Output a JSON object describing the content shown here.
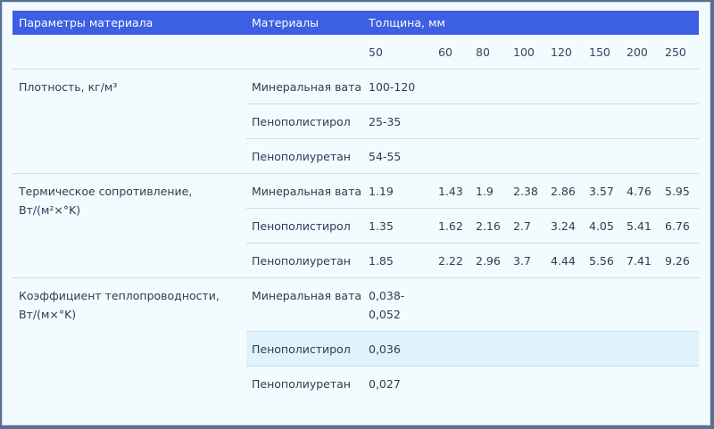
{
  "header": {
    "param_col": "Параметры материала",
    "material_col": "Материалы",
    "thickness_col": "Толщина, мм"
  },
  "thicknesses": [
    "50",
    "60",
    "80",
    "100",
    "120",
    "150",
    "200",
    "250"
  ],
  "rows": [
    {
      "param": "Плотность, кг/м³",
      "materials": [
        {
          "name": "Минеральная вата",
          "values": [
            "100-120",
            "",
            "",
            "",
            "",
            "",
            "",
            ""
          ]
        },
        {
          "name": "Пенополистирол",
          "values": [
            "25-35",
            "",
            "",
            "",
            "",
            "",
            "",
            ""
          ]
        },
        {
          "name": "Пенополиуретан",
          "values": [
            "54-55",
            "",
            "",
            "",
            "",
            "",
            "",
            ""
          ]
        }
      ]
    },
    {
      "param": "Термическое сопротивление, Вт/(м²×°K)",
      "materials": [
        {
          "name": "Минеральная вата",
          "values": [
            "1.19",
            "1.43",
            "1.9",
            "2.38",
            "2.86",
            "3.57",
            "4.76",
            "5.95"
          ]
        },
        {
          "name": "Пенополистирол",
          "values": [
            "1.35",
            "1.62",
            "2.16",
            "2.7",
            "3.24",
            "4.05",
            "5.41",
            "6.76"
          ]
        },
        {
          "name": "Пенополиуретан",
          "values": [
            "1.85",
            "2.22",
            "2.96",
            "3.7",
            "4.44",
            "5.56",
            "7.41",
            "9.26"
          ]
        }
      ]
    },
    {
      "param": "Коэффициент теплопроводности, Вт/(м×°K)",
      "materials": [
        {
          "name": "Минеральная вата",
          "values": [
            "0,038-0,052",
            "",
            "",
            "",
            "",
            "",
            "",
            ""
          ]
        },
        {
          "name": "Пенополистирол",
          "values": [
            "0,036",
            "",
            "",
            "",
            "",
            "",
            "",
            ""
          ]
        },
        {
          "name": "Пенополиуретан",
          "values": [
            "0,027",
            "",
            "",
            "",
            "",
            "",
            "",
            ""
          ]
        }
      ]
    }
  ],
  "colors": {
    "header_bg": "#3d5fe3",
    "panel_bg": "#f2fbfe",
    "highlight_bg": "#dff3fb"
  }
}
